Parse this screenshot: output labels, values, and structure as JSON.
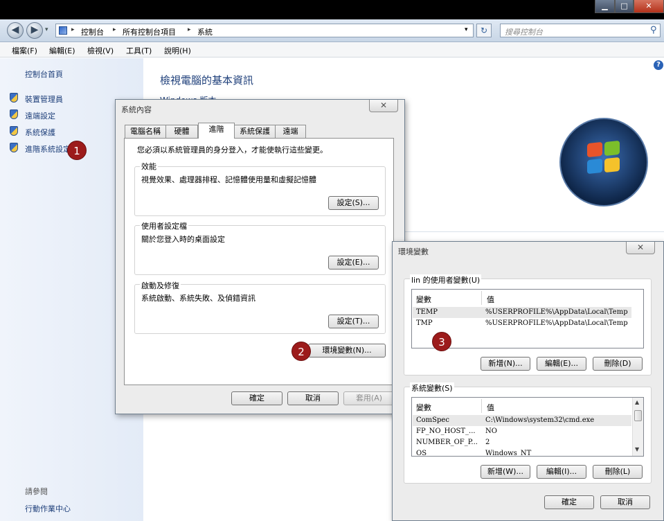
{
  "window_controls": {
    "minimize": "▁",
    "maximize": "□",
    "close": "✕"
  },
  "address": {
    "back": "◀",
    "forward": "▶",
    "history": "▾",
    "crumbs": [
      "控制台",
      "所有控制台項目",
      "系統"
    ],
    "sep": "▸",
    "dropdown": "▾",
    "refresh": "↻",
    "search_placeholder": "搜尋控制台",
    "search_icon": "⚲"
  },
  "menu": [
    "檔案(F)",
    "編輯(E)",
    "檢視(V)",
    "工具(T)",
    "說明(H)"
  ],
  "sidebar": {
    "home": "控制台首頁",
    "items": [
      "裝置管理員",
      "遠端設定",
      "系統保護",
      "進階系統設定"
    ],
    "see_also": "請參閱",
    "action_center": "行動作業中心"
  },
  "main": {
    "title": "檢視電腦的基本資訊",
    "edition_heading": "Windows 版本"
  },
  "callouts": [
    "1",
    "2",
    "3"
  ],
  "sys_dialog": {
    "title": "系統內容",
    "close": "✕",
    "tabs": [
      "電腦名稱",
      "硬體",
      "進階",
      "系統保護",
      "遠端"
    ],
    "admin_note": "您必須以系統管理員的身分登入，才能使執行這些變更。",
    "perf": {
      "label": "效能",
      "desc": "視覺效果、處理器排程、記憶體使用量和虛擬記憶體",
      "button": "設定(S)..."
    },
    "profile": {
      "label": "使用者設定檔",
      "desc": "關於您登入時的桌面設定",
      "button": "設定(E)..."
    },
    "startup": {
      "label": "啟動及修復",
      "desc": "系統啟動、系統失敗、及偵錯資訊",
      "button": "設定(T)..."
    },
    "env_button": "環境變數(N)...",
    "ok": "確定",
    "cancel": "取消",
    "apply": "套用(A)"
  },
  "env_dialog": {
    "title": "環境變數",
    "close": "✕",
    "user_group": "lin 的使用者變數(U)",
    "col_var": "變數",
    "col_val": "值",
    "user_vars": [
      {
        "name": "TEMP",
        "value": "%USERPROFILE%\\AppData\\Local\\Temp"
      },
      {
        "name": "TMP",
        "value": "%USERPROFILE%\\AppData\\Local\\Temp"
      }
    ],
    "user_new": "新增(N)...",
    "user_edit": "編輯(E)...",
    "user_delete": "刪除(D)",
    "sys_group": "系統變數(S)",
    "sys_vars": [
      {
        "name": "ComSpec",
        "value": "C:\\Windows\\system32\\cmd.exe"
      },
      {
        "name": "FP_NO_HOST_...",
        "value": "NO"
      },
      {
        "name": "NUMBER_OF_P...",
        "value": "2"
      },
      {
        "name": "OS",
        "value": "Windows_NT"
      }
    ],
    "sys_new": "新增(W)...",
    "sys_edit": "編輯(I)...",
    "sys_delete": "刪除(L)",
    "ok": "確定",
    "cancel": "取消",
    "scroll_up": "▲",
    "scroll_down": "▼"
  },
  "help": "?"
}
